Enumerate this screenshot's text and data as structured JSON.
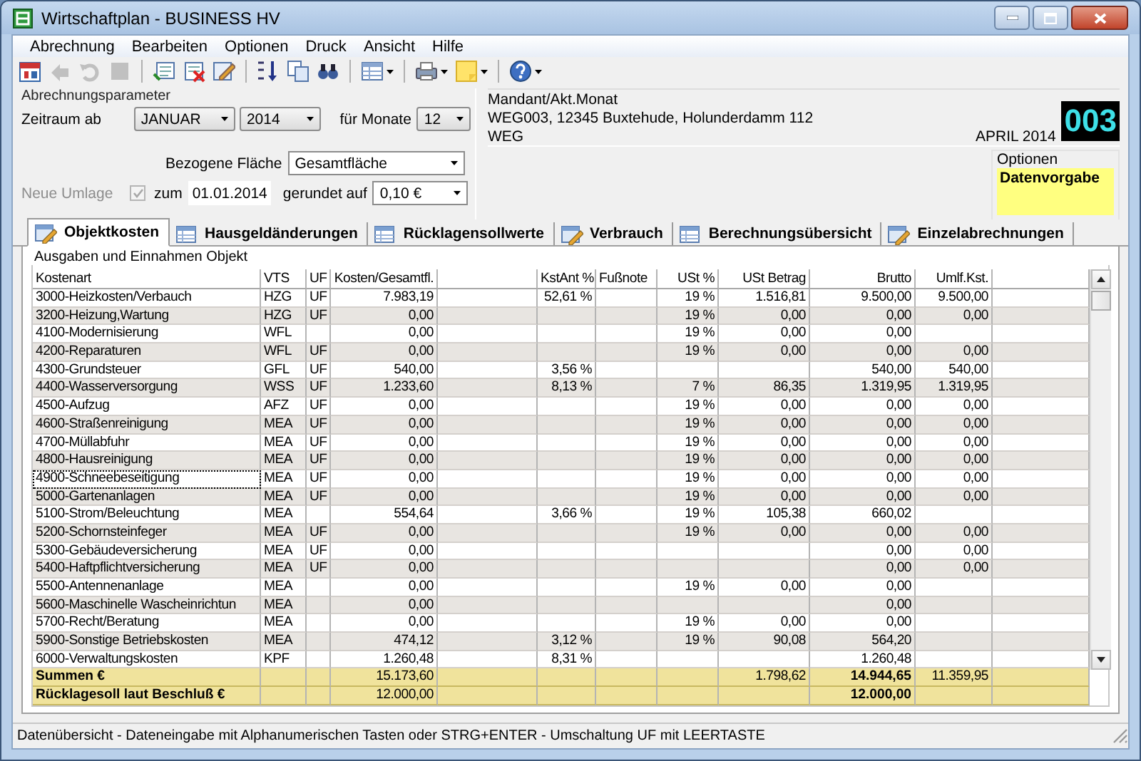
{
  "window": {
    "title": "Wirtschaftplan - BUSINESS HV"
  },
  "menu": [
    "Abrechnung",
    "Bearbeiten",
    "Optionen",
    "Druck",
    "Ansicht",
    "Hilfe"
  ],
  "toolbar": [
    [
      {
        "kind": "calendar",
        "disabled": false
      },
      {
        "kind": "back",
        "disabled": true
      },
      {
        "kind": "undo",
        "disabled": true
      },
      {
        "kind": "stop",
        "disabled": true
      }
    ],
    [
      {
        "kind": "insert",
        "disabled": false
      },
      {
        "kind": "delete",
        "disabled": false
      },
      {
        "kind": "edit",
        "disabled": false
      }
    ],
    [
      {
        "kind": "sort",
        "disabled": false
      },
      {
        "kind": "copy",
        "disabled": false
      },
      {
        "kind": "find",
        "disabled": false
      }
    ],
    [
      {
        "kind": "grid",
        "disabled": false
      }
    ],
    [
      {
        "kind": "print",
        "disabled": false
      },
      {
        "kind": "note",
        "disabled": false
      }
    ],
    [
      {
        "kind": "help",
        "disabled": false
      }
    ]
  ],
  "parameters": {
    "title": "Abrechnungsparameter",
    "period_label": "Zeitraum ab",
    "month": "JANUAR",
    "year": "2014",
    "months_label": "für Monate",
    "months": "12",
    "area_label": "Bezogene Fläche",
    "area": "Gesamtfläche",
    "new_allocation_label": "Neue Umlage",
    "new_allocation_disabled": true,
    "new_allocation_checked": true,
    "date_label": "zum",
    "date": "01.01.2014",
    "rounding_label": "gerundet auf",
    "rounding": "0,10 €"
  },
  "client": {
    "title": "Mandant/Akt.Monat",
    "line_1": "WEG003, 12345 Buxtehude, Holunderdamm 112",
    "line_2": "WEG",
    "month": "APRIL 2014",
    "number": "003"
  },
  "options": {
    "title": "Optionen",
    "value": "Datenvorgabe"
  },
  "tabs": [
    {
      "label": "Objektkosten",
      "selected": true
    },
    {
      "label": "Hausgeldänderungen",
      "selected": false
    },
    {
      "label": "Rücklagensollwerte",
      "selected": false
    },
    {
      "label": "Verbrauch",
      "selected": false
    },
    {
      "label": "Berechnungsübersicht",
      "selected": false
    },
    {
      "label": "Einzelabrechnungen",
      "selected": false
    }
  ],
  "table": {
    "title": "Ausgaben und Einnahmen Objekt",
    "columns": [
      "Kostenart",
      "VTS",
      "UF",
      "Kosten/Gesamtfl.",
      "",
      "KstAnt %",
      "Fußnote",
      "USt %",
      "USt Betrag",
      "Brutto",
      "Umlf.Kst.",
      ""
    ],
    "rows": [
      {
        "focused": false,
        "cells": [
          "3000-Heizkosten/Verbauch",
          "HZG",
          "UF",
          "7.983,19",
          "",
          "52,61 %",
          "",
          "19 %",
          "1.516,81",
          "9.500,00",
          "9.500,00",
          ""
        ]
      },
      {
        "focused": false,
        "cells": [
          "3200-Heizung,Wartung",
          "HZG",
          "UF",
          "0,00",
          "",
          "",
          "",
          "19 %",
          "0,00",
          "0,00",
          "0,00",
          ""
        ]
      },
      {
        "focused": false,
        "cells": [
          "4100-Modernisierung",
          "WFL",
          "",
          "0,00",
          "",
          "",
          "",
          "19 %",
          "0,00",
          "0,00",
          "",
          ""
        ]
      },
      {
        "focused": false,
        "cells": [
          "4200-Reparaturen",
          "WFL",
          "UF",
          "0,00",
          "",
          "",
          "",
          "19 %",
          "0,00",
          "0,00",
          "0,00",
          ""
        ]
      },
      {
        "focused": false,
        "cells": [
          "4300-Grundsteuer",
          "GFL",
          "UF",
          "540,00",
          "",
          "3,56 %",
          "",
          "",
          "",
          "540,00",
          "540,00",
          ""
        ]
      },
      {
        "focused": false,
        "cells": [
          "4400-Wasserversorgung",
          "WSS",
          "UF",
          "1.233,60",
          "",
          "8,13 %",
          "",
          "7 %",
          "86,35",
          "1.319,95",
          "1.319,95",
          ""
        ]
      },
      {
        "focused": false,
        "cells": [
          "4500-Aufzug",
          "AFZ",
          "UF",
          "0,00",
          "",
          "",
          "",
          "19 %",
          "0,00",
          "0,00",
          "0,00",
          ""
        ]
      },
      {
        "focused": false,
        "cells": [
          "4600-Straßenreinigung",
          "MEA",
          "UF",
          "0,00",
          "",
          "",
          "",
          "19 %",
          "0,00",
          "0,00",
          "0,00",
          ""
        ]
      },
      {
        "focused": false,
        "cells": [
          "4700-Müllabfuhr",
          "MEA",
          "UF",
          "0,00",
          "",
          "",
          "",
          "19 %",
          "0,00",
          "0,00",
          "0,00",
          ""
        ]
      },
      {
        "focused": false,
        "cells": [
          "4800-Hausreinigung",
          "MEA",
          "UF",
          "0,00",
          "",
          "",
          "",
          "19 %",
          "0,00",
          "0,00",
          "0,00",
          ""
        ]
      },
      {
        "focused": true,
        "cells": [
          "4900-Schneebeseitigung",
          "MEA",
          "UF",
          "0,00",
          "",
          "",
          "",
          "19 %",
          "0,00",
          "0,00",
          "0,00",
          ""
        ]
      },
      {
        "focused": false,
        "cells": [
          "5000-Gartenanlagen",
          "MEA",
          "UF",
          "0,00",
          "",
          "",
          "",
          "19 %",
          "0,00",
          "0,00",
          "0,00",
          ""
        ]
      },
      {
        "focused": false,
        "cells": [
          "5100-Strom/Beleuchtung",
          "MEA",
          "",
          "554,64",
          "",
          "3,66 %",
          "",
          "19 %",
          "105,38",
          "660,02",
          "",
          ""
        ]
      },
      {
        "focused": false,
        "cells": [
          "5200-Schornsteinfeger",
          "MEA",
          "UF",
          "0,00",
          "",
          "",
          "",
          "19 %",
          "0,00",
          "0,00",
          "0,00",
          ""
        ]
      },
      {
        "focused": false,
        "cells": [
          "5300-Gebäudeversicherung",
          "MEA",
          "UF",
          "0,00",
          "",
          "",
          "",
          "",
          "",
          "0,00",
          "0,00",
          ""
        ]
      },
      {
        "focused": false,
        "cells": [
          "5400-Haftpflichtversicherung",
          "MEA",
          "UF",
          "0,00",
          "",
          "",
          "",
          "",
          "",
          "0,00",
          "0,00",
          ""
        ]
      },
      {
        "focused": false,
        "cells": [
          "5500-Antennenanlage",
          "MEA",
          "",
          "0,00",
          "",
          "",
          "",
          "19 %",
          "0,00",
          "0,00",
          "",
          ""
        ]
      },
      {
        "focused": false,
        "cells": [
          "5600-Maschinelle Wascheinrichtun",
          "MEA",
          "",
          "0,00",
          "",
          "",
          "",
          "",
          "",
          "0,00",
          "",
          ""
        ]
      },
      {
        "focused": false,
        "cells": [
          "5700-Recht/Beratung",
          "MEA",
          "",
          "0,00",
          "",
          "",
          "",
          "19 %",
          "0,00",
          "0,00",
          "",
          ""
        ]
      },
      {
        "focused": false,
        "cells": [
          "5900-Sonstige Betriebskosten",
          "MEA",
          "",
          "474,12",
          "",
          "3,12 %",
          "",
          "19 %",
          "90,08",
          "564,20",
          "",
          ""
        ]
      },
      {
        "focused": false,
        "cells": [
          "6000-Verwaltungskosten",
          "KPF",
          "",
          "1.260,48",
          "",
          "8,31 %",
          "",
          "",
          "",
          "1.260,48",
          "",
          ""
        ]
      }
    ],
    "totals": [
      {
        "cells": [
          "Summen €",
          "",
          "",
          "15.173,60",
          "",
          "",
          "",
          "",
          "1.798,62",
          "14.944,65",
          "11.359,95",
          ""
        ]
      },
      {
        "cells": [
          "Rücklagesoll laut Beschluß €",
          "",
          "",
          "12.000,00",
          "",
          "",
          "",
          "",
          "",
          "12.000,00",
          "",
          ""
        ]
      }
    ]
  },
  "status_bar": "Datenübersicht - Dateneingabe mit Alphanumerischen Tasten oder STRG+ENTER - Umschaltung UF mit LEERTASTE"
}
